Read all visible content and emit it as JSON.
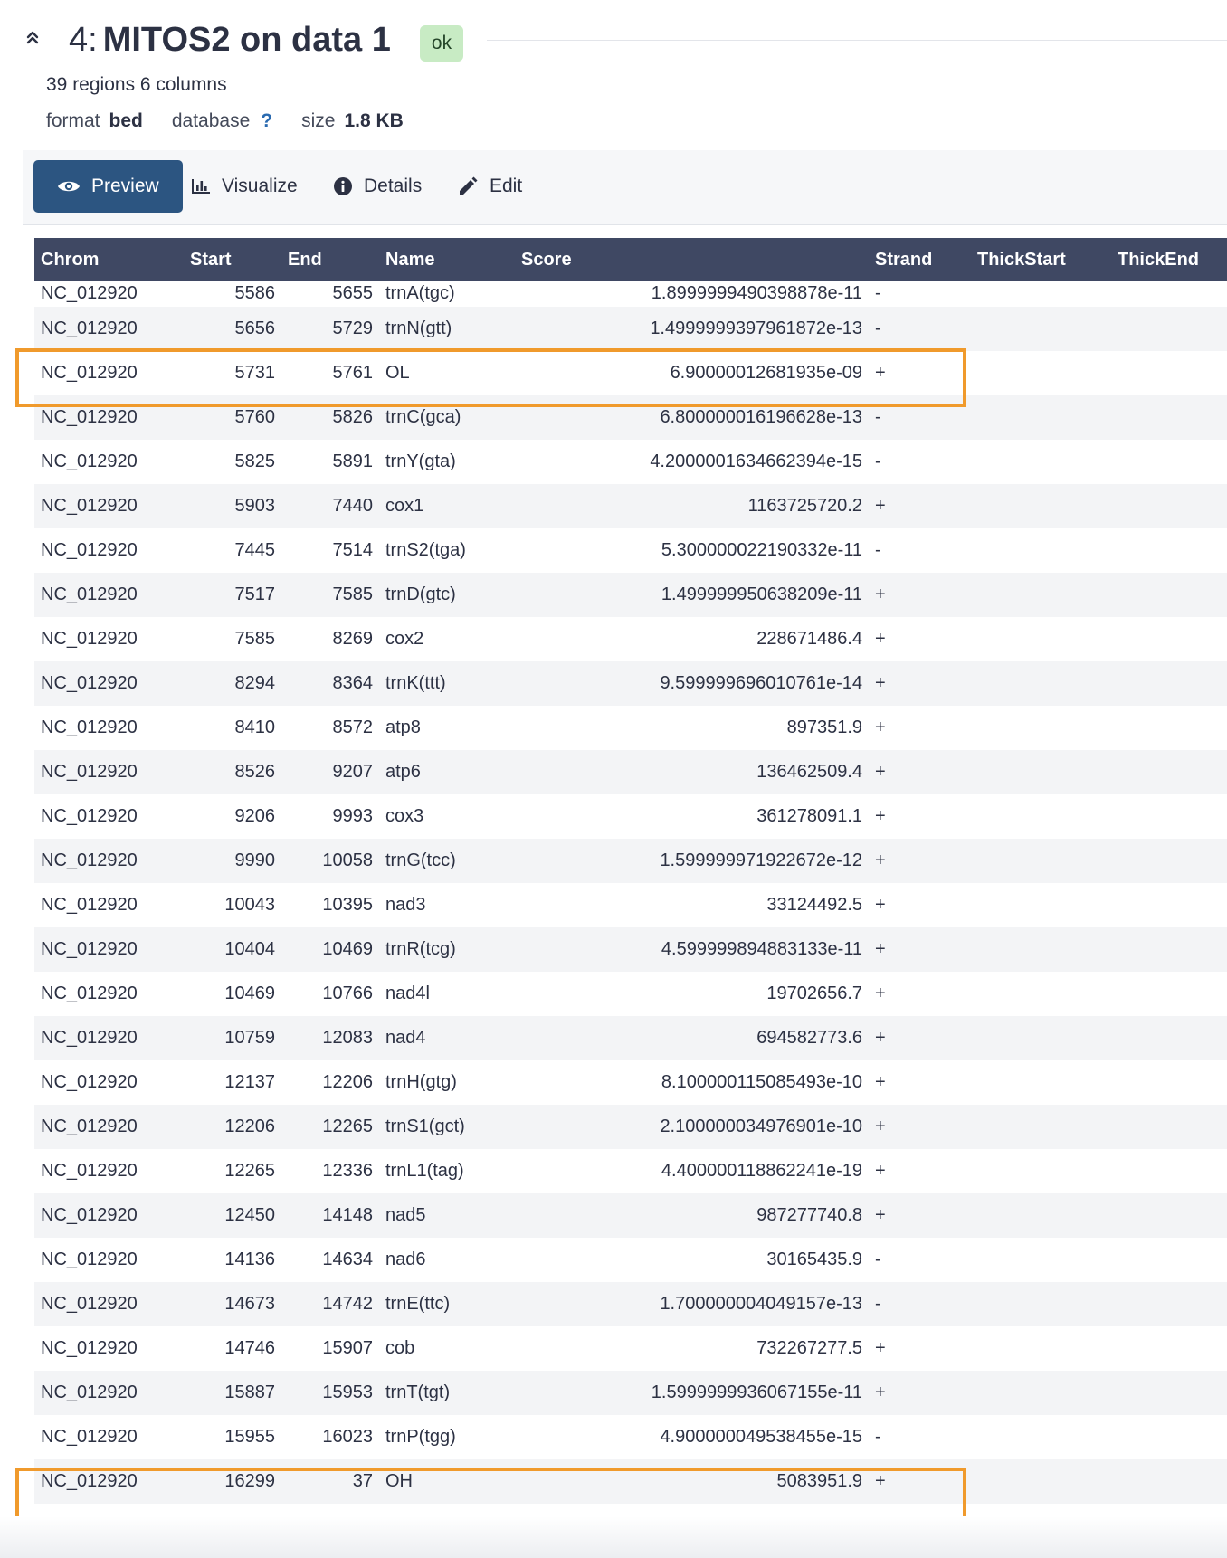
{
  "dataset": {
    "hid": "4:",
    "name": "MITOS2 on data 1",
    "state": "ok",
    "summary": "39 regions 6 columns",
    "format_label": "format",
    "format": "bed",
    "database_label": "database",
    "database": "?",
    "size_label": "size",
    "size": "1.8 KB"
  },
  "tabs": [
    {
      "label": "Preview",
      "icon": "eye-icon",
      "active": true
    },
    {
      "label": "Visualize",
      "icon": "bar-chart-icon",
      "active": false
    },
    {
      "label": "Details",
      "icon": "info-icon",
      "active": false
    },
    {
      "label": "Edit",
      "icon": "pencil-icon",
      "active": false
    }
  ],
  "table": {
    "columns": [
      "Chrom",
      "Start",
      "End",
      "Name",
      "Score",
      "Strand",
      "ThickStart",
      "ThickEnd"
    ],
    "rows": [
      [
        "NC_012920",
        "5586",
        "5655",
        "trnA(tgc)",
        "1.8999999490398878e-11",
        "-"
      ],
      [
        "NC_012920",
        "5656",
        "5729",
        "trnN(gtt)",
        "1.4999999397961872e-13",
        "-"
      ],
      [
        "NC_012920",
        "5731",
        "5761",
        "OL",
        "6.90000012681935e-09",
        "+"
      ],
      [
        "NC_012920",
        "5760",
        "5826",
        "trnC(gca)",
        "6.800000016196628e-13",
        "-"
      ],
      [
        "NC_012920",
        "5825",
        "5891",
        "trnY(gta)",
        "4.2000001634662394e-15",
        "-"
      ],
      [
        "NC_012920",
        "5903",
        "7440",
        "cox1",
        "1163725720.2",
        "+"
      ],
      [
        "NC_012920",
        "7445",
        "7514",
        "trnS2(tga)",
        "5.300000022190332e-11",
        "-"
      ],
      [
        "NC_012920",
        "7517",
        "7585",
        "trnD(gtc)",
        "1.499999950638209e-11",
        "+"
      ],
      [
        "NC_012920",
        "7585",
        "8269",
        "cox2",
        "228671486.4",
        "+"
      ],
      [
        "NC_012920",
        "8294",
        "8364",
        "trnK(ttt)",
        "9.599999696010761e-14",
        "+"
      ],
      [
        "NC_012920",
        "8410",
        "8572",
        "atp8",
        "897351.9",
        "+"
      ],
      [
        "NC_012920",
        "8526",
        "9207",
        "atp6",
        "136462509.4",
        "+"
      ],
      [
        "NC_012920",
        "9206",
        "9993",
        "cox3",
        "361278091.1",
        "+"
      ],
      [
        "NC_012920",
        "9990",
        "10058",
        "trnG(tcc)",
        "1.599999971922672e-12",
        "+"
      ],
      [
        "NC_012920",
        "10043",
        "10395",
        "nad3",
        "33124492.5",
        "+"
      ],
      [
        "NC_012920",
        "10404",
        "10469",
        "trnR(tcg)",
        "4.599999894883133e-11",
        "+"
      ],
      [
        "NC_012920",
        "10469",
        "10766",
        "nad4l",
        "19702656.7",
        "+"
      ],
      [
        "NC_012920",
        "10759",
        "12083",
        "nad4",
        "694582773.6",
        "+"
      ],
      [
        "NC_012920",
        "12137",
        "12206",
        "trnH(gtg)",
        "8.100000115085493e-10",
        "+"
      ],
      [
        "NC_012920",
        "12206",
        "12265",
        "trnS1(gct)",
        "2.100000034976901e-10",
        "+"
      ],
      [
        "NC_012920",
        "12265",
        "12336",
        "trnL1(tag)",
        "4.400000118862241e-19",
        "+"
      ],
      [
        "NC_012920",
        "12450",
        "14148",
        "nad5",
        "987277740.8",
        "+"
      ],
      [
        "NC_012920",
        "14136",
        "14634",
        "nad6",
        "30165435.9",
        "-"
      ],
      [
        "NC_012920",
        "14673",
        "14742",
        "trnE(ttc)",
        "1.700000004049157e-13",
        "-"
      ],
      [
        "NC_012920",
        "14746",
        "15907",
        "cob",
        "732267277.5",
        "+"
      ],
      [
        "NC_012920",
        "15887",
        "15953",
        "trnT(tgt)",
        "1.5999999936067155e-11",
        "+"
      ],
      [
        "NC_012920",
        "15955",
        "16023",
        "trnP(tgg)",
        "4.900000049538455e-15",
        "-"
      ],
      [
        "NC_012920",
        "16299",
        "37",
        "OH",
        "5083951.9",
        "+"
      ]
    ],
    "highlighted_rows": [
      2,
      27
    ]
  },
  "colors": {
    "header_bg": "#3f4863",
    "active_tab": "#2c5581",
    "ok_badge": "#c8ebc4",
    "highlight": "#f09a2c"
  }
}
